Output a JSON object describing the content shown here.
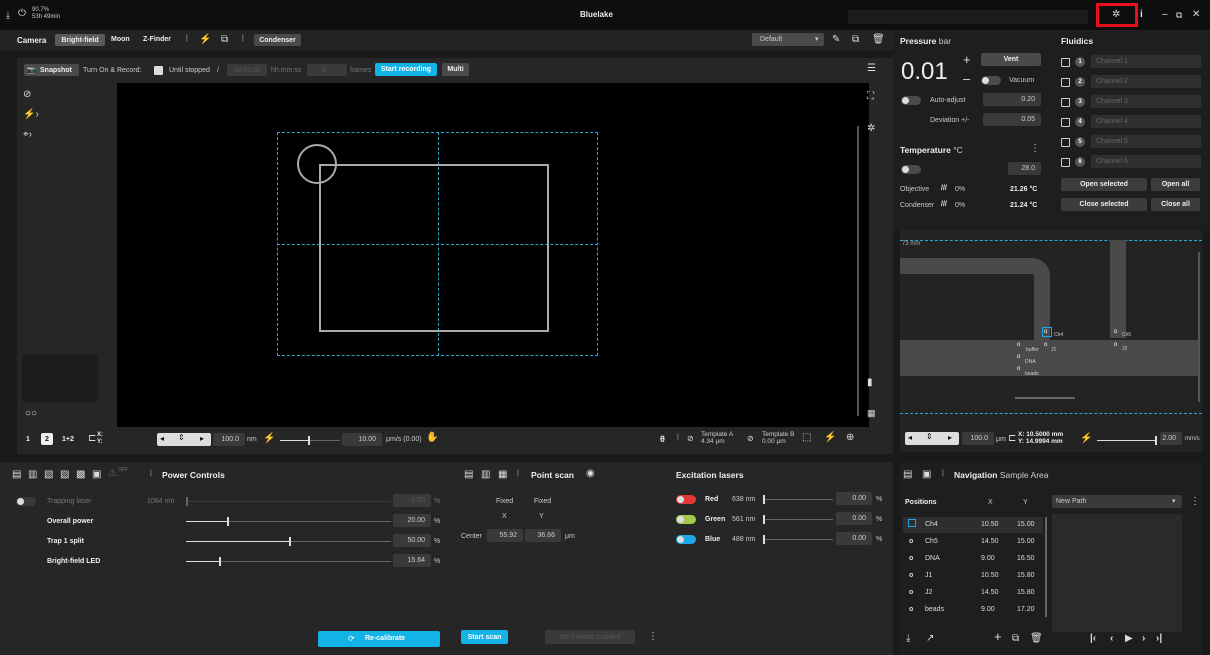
{
  "topbar": {
    "battery_pct": "90.7%",
    "battery_time": "53h 49min",
    "title": "Bluelake"
  },
  "camera": {
    "label": "Camera",
    "modes": [
      "Bright-field",
      "Moon",
      "Z-Finder"
    ],
    "condenser_label": "Condenser",
    "preset": "Default",
    "snapshot_label": "Snapshot",
    "turn_on_record": "Turn On & Record:",
    "until_stopped": "Until stopped",
    "slash": "/",
    "time_placeholder": "00:00:00",
    "time_unit": "hh:mm:ss",
    "frames_value": "0",
    "frames_unit": "frames",
    "start_recording": "Start recording",
    "multi": "Multi"
  },
  "view_controls": {
    "btn1": "1",
    "btn2": "2",
    "btn12": "1+2",
    "xy_label": "X:\nY:",
    "zoom_value": "100.0",
    "zoom_unit": "nm",
    "speed_value": "10.00",
    "speed_unit": "μm/s (0.00)",
    "theta": "θ",
    "template_a": "Template A",
    "template_a_val": "4.34 μm",
    "template_b": "Template B",
    "template_b_val": "0.00 μm"
  },
  "pressure": {
    "title": "Pressure",
    "unit": "bar",
    "value": "0.01",
    "vent": "Vent",
    "vacuum": "Vacuum",
    "auto_adjust": "Auto-adjust",
    "auto_value": "0.20",
    "deviation_label": "Deviation +/-",
    "deviation_value": "0.05"
  },
  "temperature": {
    "title": "Temperature",
    "unit": "°C",
    "setpoint": "28.0",
    "objective_label": "Objective",
    "objective_pct": "0%",
    "objective_temp": "21.26 °C",
    "condenser_label": "Condenser",
    "condenser_pct": "0%",
    "condenser_temp": "21.24 °C"
  },
  "fluidics": {
    "title": "Fluidics",
    "channels": [
      {
        "num": "1",
        "label": "Channel 1"
      },
      {
        "num": "2",
        "label": "Channel 2"
      },
      {
        "num": "3",
        "label": "Channel 3"
      },
      {
        "num": "4",
        "label": "Channel 4"
      },
      {
        "num": "5",
        "label": "Channel 5"
      },
      {
        "num": "6",
        "label": "Channel 6"
      }
    ],
    "open_selected": "Open selected",
    "open_all": "Open all",
    "close_selected": "Close selected",
    "close_all": "Close all"
  },
  "map": {
    "scale": "73 mm",
    "labels": [
      "Ch4",
      "Ch5",
      "buffer",
      "J1",
      "J2",
      "DNA",
      "beads"
    ],
    "zoom_value": "100.0",
    "zoom_unit": "μm",
    "x_coord": "X: 10.5000 mm",
    "y_coord": "Y: 14.9994 mm",
    "speed_value": "2.00",
    "speed_unit": "mm/s"
  },
  "power": {
    "title": "Power Controls",
    "off_label": "OFF",
    "trapping_label": "Trapping laser",
    "trapping_wl": "1064 nm",
    "trapping_value": "0.00",
    "rows": [
      {
        "label": "Overall power",
        "value": "20.00",
        "fill": 0.2
      },
      {
        "label": "Trap 1 split",
        "value": "50.00",
        "fill": 0.5
      },
      {
        "label": "Bright-field LED",
        "value": "15.64",
        "fill": 0.16
      }
    ],
    "pct": "%",
    "recalibrate": "Re-calibrate"
  },
  "point_scan": {
    "title": "Point scan",
    "fixed": "Fixed",
    "x": "X",
    "y": "Y",
    "center_label": "Center",
    "center_x": "55.92",
    "center_y": "36.66",
    "unit": "μm",
    "start_scan": "Start scan",
    "no_presets": "No Presets Loaded"
  },
  "lasers": {
    "title": "Excitation lasers",
    "rows": [
      {
        "name": "Red",
        "wl": "638 nm",
        "value": "0.00",
        "color": "#e23a3a"
      },
      {
        "name": "Green",
        "wl": "561 nm",
        "value": "0.00",
        "color": "#a6c84a"
      },
      {
        "name": "Blue",
        "wl": "488 nm",
        "value": "0.00",
        "color": "#1ea8e8"
      }
    ],
    "pct": "%"
  },
  "navigation": {
    "title": "Navigation",
    "subtitle": "Sample Area",
    "positions_header": "Positions",
    "x_header": "X",
    "y_header": "Y",
    "path": "New Path",
    "rows": [
      {
        "name": "Ch4",
        "x": "10.50",
        "y": "15.00"
      },
      {
        "name": "Ch5",
        "x": "14.50",
        "y": "15.00"
      },
      {
        "name": "DNA",
        "x": "9.00",
        "y": "16.50"
      },
      {
        "name": "J1",
        "x": "10.50",
        "y": "15.80"
      },
      {
        "name": "J2",
        "x": "14.50",
        "y": "15.80"
      },
      {
        "name": "beads",
        "x": "9.00",
        "y": "17.20"
      }
    ]
  }
}
